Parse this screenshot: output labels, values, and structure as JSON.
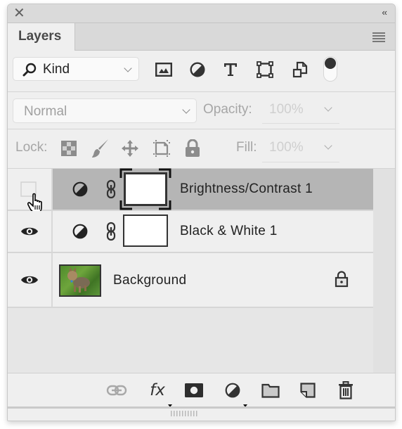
{
  "panel": {
    "close_icon": "close-x-icon",
    "collapse_label": "‹‹",
    "tab_label": "Layers",
    "menu_icon": "panel-menu-icon"
  },
  "filter": {
    "kind_label": "Kind",
    "filter_icons": [
      "pixel-layer-filter-icon",
      "adjustment-layer-filter-icon",
      "type-layer-filter-icon",
      "shape-layer-filter-icon",
      "smart-object-filter-icon"
    ],
    "type_glyph": "T",
    "toggle_on": true
  },
  "blend": {
    "mode": "Normal",
    "opacity_label": "Opacity:",
    "opacity_value": "100%"
  },
  "lock": {
    "label": "Lock:",
    "icons": [
      "lock-transparent-pixels-icon",
      "lock-image-pixels-icon",
      "lock-position-icon",
      "lock-artboard-icon",
      "lock-all-icon"
    ],
    "fill_label": "Fill:",
    "fill_value": "100%"
  },
  "layers": [
    {
      "name": "Brightness/Contrast 1",
      "type": "adjustment",
      "visible": false,
      "selected": true
    },
    {
      "name": "Black & White 1",
      "type": "adjustment",
      "visible": true,
      "selected": false
    },
    {
      "name": "Background",
      "type": "pixel",
      "visible": true,
      "selected": false,
      "locked": true
    }
  ],
  "bottom": {
    "fx_label": "fx",
    "icons": [
      "link-layers-icon",
      "layer-style-icon",
      "add-mask-icon",
      "new-adjustment-layer-icon",
      "new-group-icon",
      "new-layer-icon",
      "delete-layer-icon"
    ]
  }
}
